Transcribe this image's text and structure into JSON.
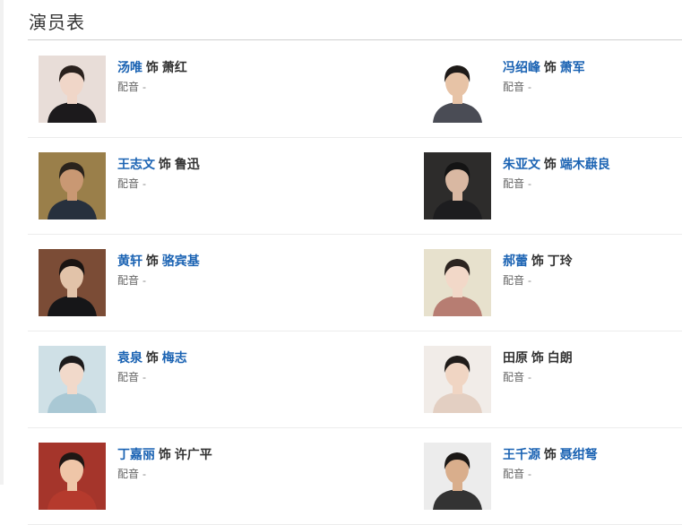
{
  "title": "演员表",
  "voice_label": "配音",
  "rows": [
    {
      "left": {
        "actor": "汤唯",
        "role": "萧红",
        "voice": "-",
        "actor_link": true,
        "role_link": false,
        "photo": {
          "bg": "#e8ddd8",
          "skin": "#f0d6c8",
          "hair": "#2a211d",
          "cloth": "#1c1a1c"
        }
      },
      "right": {
        "actor": "冯绍峰",
        "role": "萧军",
        "voice": "-",
        "actor_link": true,
        "role_link": true,
        "photo": {
          "bg": "#ffffff",
          "skin": "#e7c3a6",
          "hair": "#1e1a18",
          "cloth": "#4a4c55"
        }
      }
    },
    {
      "left": {
        "actor": "王志文",
        "role": "鲁迅",
        "voice": "-",
        "actor_link": true,
        "role_link": false,
        "photo": {
          "bg": "#9a7f4a",
          "skin": "#c99873",
          "hair": "#2a231c",
          "cloth": "#27303d"
        }
      },
      "right": {
        "actor": "朱亚文",
        "role": "端木蕻良",
        "voice": "-",
        "actor_link": true,
        "role_link": true,
        "photo": {
          "bg": "#2d2c2b",
          "skin": "#d9b8a2",
          "hair": "#141414",
          "cloth": "#1d1d1f"
        }
      }
    },
    {
      "left": {
        "actor": "黄轩",
        "role": "骆宾基",
        "voice": "-",
        "actor_link": true,
        "role_link": true,
        "photo": {
          "bg": "#7b4c36",
          "skin": "#e2c3a9",
          "hair": "#1a1412",
          "cloth": "#161618"
        }
      },
      "right": {
        "actor": "郝蕾",
        "role": "丁玲",
        "voice": "-",
        "actor_link": true,
        "role_link": false,
        "photo": {
          "bg": "#e7e1cd",
          "skin": "#f2d8c8",
          "hair": "#2c2420",
          "cloth": "#b77d72"
        }
      }
    },
    {
      "left": {
        "actor": "袁泉",
        "role": "梅志",
        "voice": "-",
        "actor_link": true,
        "role_link": true,
        "photo": {
          "bg": "#cfe0e6",
          "skin": "#f1d9ca",
          "hair": "#1c1a1b",
          "cloth": "#a9c8d4"
        }
      },
      "right": {
        "actor": "田原",
        "role": "白朗",
        "voice": "-",
        "actor_link": false,
        "role_link": false,
        "photo": {
          "bg": "#f1ece8",
          "skin": "#f0d5c3",
          "hair": "#201c1a",
          "cloth": "#e3cfc2"
        }
      }
    },
    {
      "left": {
        "actor": "丁嘉丽",
        "role": "许广平",
        "voice": "-",
        "actor_link": true,
        "role_link": false,
        "photo": {
          "bg": "#a5352b",
          "skin": "#efc6a8",
          "hair": "#1f1714",
          "cloth": "#b53a2d"
        }
      },
      "right": {
        "actor": "王千源",
        "role": "聂绀弩",
        "voice": "-",
        "actor_link": true,
        "role_link": true,
        "photo": {
          "bg": "#ececec",
          "skin": "#d9ae8c",
          "hair": "#1b1816",
          "cloth": "#333333"
        }
      }
    }
  ],
  "role_connector": "饰"
}
